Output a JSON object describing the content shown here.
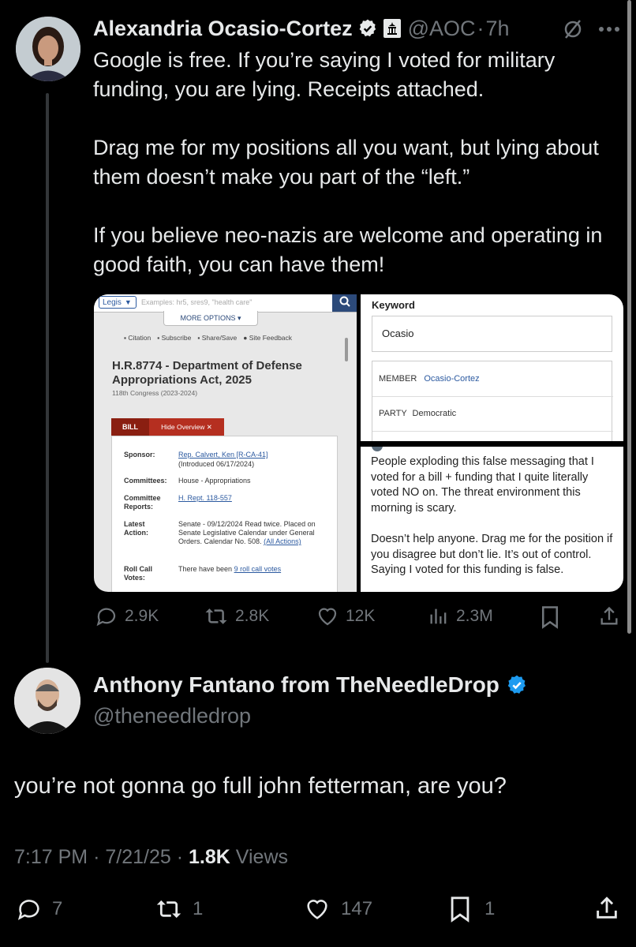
{
  "tweet": {
    "author_name": "Alexandria Ocasio-Cortez",
    "handle": "@AOC",
    "separator": "·",
    "time": "7h",
    "text": "Google is free. If you’re saying I voted for military funding, you are lying. Receipts attached.\n\nDrag me for my positions all you want, but lying about them doesn’t make you part of the “left.”\n\nIf you believe neo-nazis are welcome and operating in good faith, you can have them!",
    "icons": [
      "verified-badge-icon",
      "capitol-badge-icon",
      "grok-icon",
      "more-icon"
    ],
    "actions": {
      "replies": "2.9K",
      "reposts": "2.8K",
      "likes": "12K",
      "views": "2.3M"
    },
    "colors": {
      "verified": "#1d9bf0",
      "muted": "#71767b",
      "text": "#e7e9ea",
      "background": "#000000"
    }
  },
  "media": {
    "legis": {
      "brand": "Legis",
      "search_placeholder": "Examples: hr5, sres9, \"health care\"",
      "more_options": "MORE OPTIONS",
      "tools": [
        "Citation",
        "Subscribe",
        "Share/Save",
        "Site Feedback"
      ],
      "bill_title": "H.R.8774 - Department of Defense Appropriations Act, 2025",
      "congress": "118th Congress (2023-2024)",
      "tab_bill": "BILL",
      "tab_overview": "Hide Overview",
      "rows": [
        {
          "label": "Sponsor:",
          "value": "Rep. Calvert, Ken [R-CA-41]",
          "sub": "(Introduced 06/17/2024)"
        },
        {
          "label": "Committees:",
          "value": "House - Appropriations"
        },
        {
          "label": "Committee Reports:",
          "value": "H. Rept. 118-557"
        },
        {
          "label": "Latest Action:",
          "value": "Senate - 09/12/2024 Read twice. Placed on Senate Legislative Calendar under General Orders. Calendar No. 508.",
          "link": "(All Actions)"
        },
        {
          "label": "Roll Call Votes:",
          "value": "There have been",
          "link": "9 roll call votes"
        }
      ]
    },
    "keyword": {
      "label": "Keyword",
      "input_value": "Ocasio",
      "member_label": "MEMBER",
      "member_value": "Ocasio-Cortez",
      "party_label": "PARTY",
      "party_value": "Democratic"
    },
    "quote": {
      "p1": "People exploding this false messaging that I voted for a bill + funding that I quite literally voted NO on. The threat environment this morning is scary.",
      "p2": "Doesn’t help anyone. Drag me for the position if you disagree but don’t lie. It’s out of control. Saying I voted for this funding is false."
    }
  },
  "reply": {
    "author_name": "Anthony Fantano from TheNeedleDrop",
    "handle": "@theneedledrop",
    "text": "you’re not gonna go full john fetterman, are you?",
    "time": "7:17 PM",
    "date": "7/21/25",
    "separator": "·",
    "views_count": "1.8K",
    "views_label": "Views",
    "actions": {
      "replies": "7",
      "reposts": "1",
      "likes": "147",
      "bookmarks": "1"
    }
  }
}
